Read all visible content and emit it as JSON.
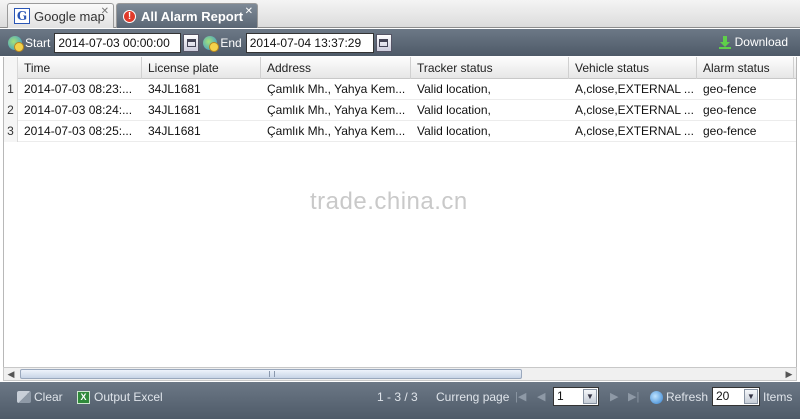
{
  "tabs": [
    {
      "label": "Google map",
      "icon": "google-map-icon",
      "active": false
    },
    {
      "label": "All Alarm Report",
      "icon": "alarm-icon",
      "active": true
    }
  ],
  "toolbar": {
    "start_label": "Start",
    "start_value": "2014-07-03 00:00:00",
    "end_label": "End",
    "end_value": "2014-07-04 13:37:29",
    "download_label": "Download"
  },
  "table": {
    "columns": [
      "Time",
      "License plate",
      "Address",
      "Tracker status",
      "Vehicle status",
      "Alarm status"
    ],
    "rows": [
      {
        "num": "1",
        "time": "2014-07-03 08:23:...",
        "plate": "34JL1681",
        "address": "Çamlık Mh., Yahya Kem...",
        "tracker": "Valid location,",
        "vehicle": "A,close,EXTERNAL ...",
        "alarm": "geo-fence"
      },
      {
        "num": "2",
        "time": "2014-07-03 08:24:...",
        "plate": "34JL1681",
        "address": "Çamlık Mh., Yahya Kem...",
        "tracker": "Valid location,",
        "vehicle": "A,close,EXTERNAL ...",
        "alarm": "geo-fence"
      },
      {
        "num": "3",
        "time": "2014-07-03 08:25:...",
        "plate": "34JL1681",
        "address": "Çamlık Mh., Yahya Kem...",
        "tracker": "Valid location,",
        "vehicle": "A,close,EXTERNAL ...",
        "alarm": "geo-fence"
      }
    ]
  },
  "watermark": "trade.china.cn",
  "bottom": {
    "clear_label": "Clear",
    "output_excel_label": "Output Excel",
    "range_text": "1 - 3 / 3",
    "current_page_label": "Curreng page",
    "current_page_value": "1",
    "refresh_label": "Refresh",
    "items_value": "20",
    "items_label": "Items"
  },
  "colors": {
    "toolbar_bg": "#5e6a78",
    "active_tab_bg": "#6b7785",
    "grid_header_bg": "#efefef"
  }
}
